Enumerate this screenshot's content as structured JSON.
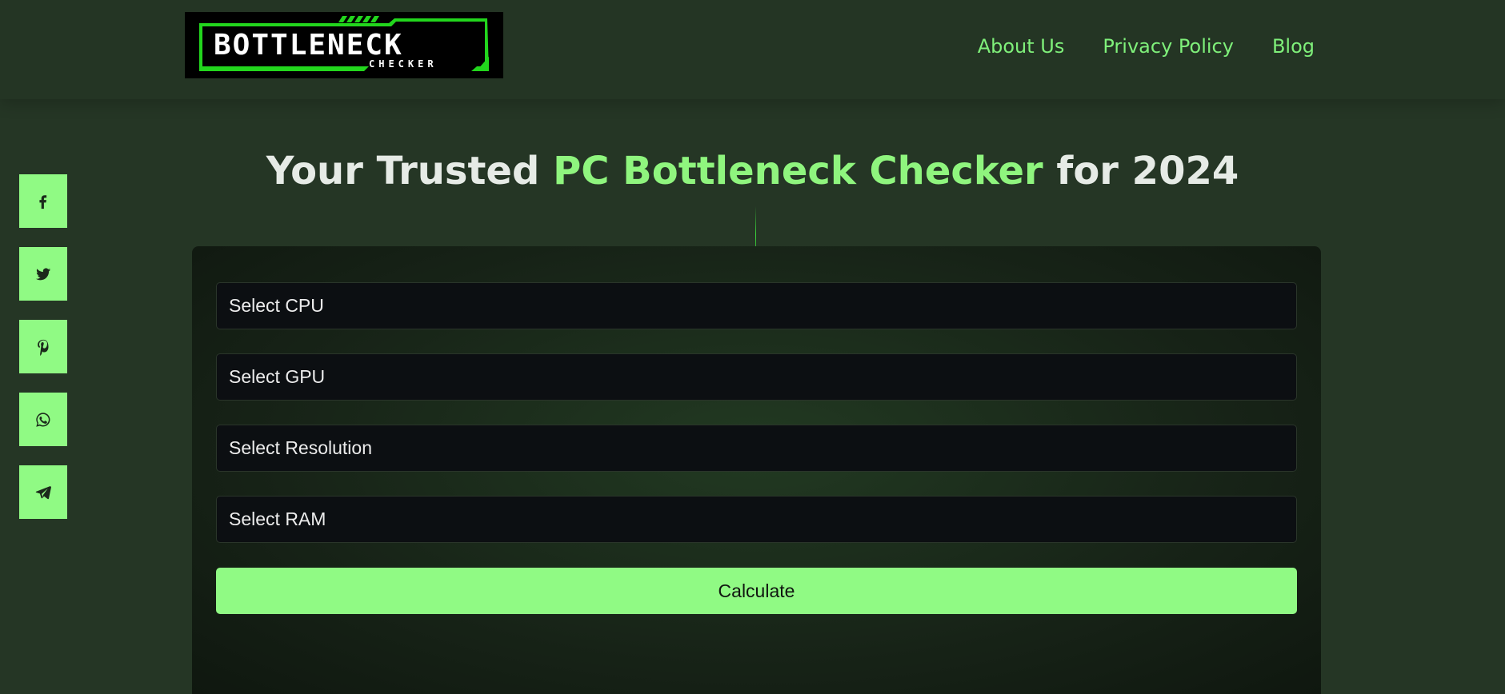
{
  "logo": {
    "text_main": "BOTTLENECK",
    "text_sub": "CHECKER",
    "accent_color": "#22d61d"
  },
  "nav": {
    "about": "About Us",
    "privacy": "Privacy Policy",
    "blog": "Blog"
  },
  "hero": {
    "title_pre": "Your Trusted ",
    "title_accent": "PC Bottleneck Checker",
    "title_post": " for 2024"
  },
  "social": [
    "facebook-icon",
    "twitter-icon",
    "pinterest-icon",
    "whatsapp-icon",
    "telegram-icon"
  ],
  "form": {
    "cpu_label": "Select CPU",
    "gpu_label": "Select GPU",
    "resolution_label": "Select Resolution",
    "ram_label": "Select RAM",
    "calculate_label": "Calculate"
  },
  "colors": {
    "accent": "#90fa84",
    "background": "#253625",
    "link": "#7ff07a"
  }
}
